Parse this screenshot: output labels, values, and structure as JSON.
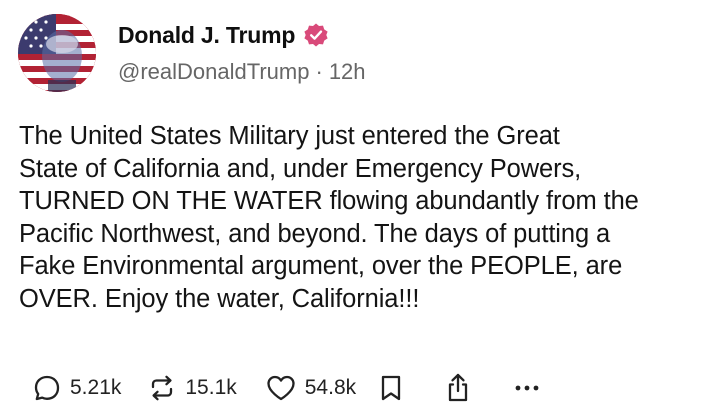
{
  "author": {
    "display_name": "Donald J. Trump",
    "handle": "@realDonaldTrump",
    "separator": "·",
    "time_ago": "12h",
    "verified": true,
    "verified_color": "#d94a7a"
  },
  "post": {
    "text": "The United States Military just entered the Great\nState of California and, under Emergency Powers,\nTURNED ON THE WATER flowing abundantly from the\nPacific Northwest, and beyond. The days of putting a\nFake Environmental argument, over the PEOPLE, are\nOVER. Enjoy the water, California!!!"
  },
  "actions": {
    "replies": "5.21k",
    "reposts": "15.1k",
    "likes": "54.8k",
    "icons": [
      "reply-icon",
      "repost-icon",
      "like-icon",
      "bookmark-icon",
      "share-icon",
      "more-icon"
    ]
  }
}
